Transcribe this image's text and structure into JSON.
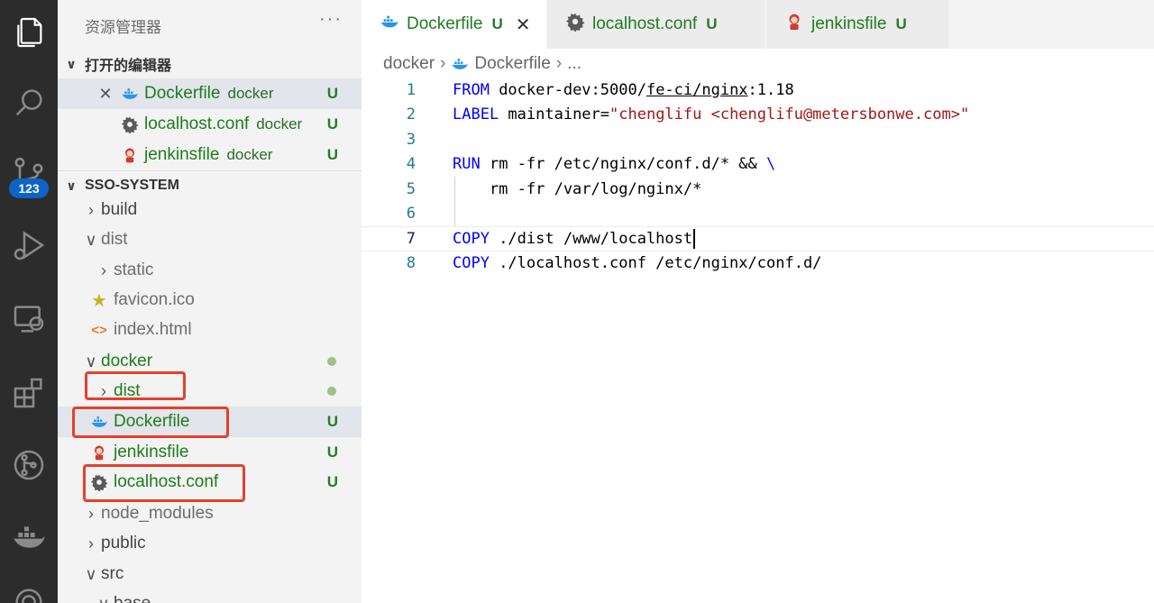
{
  "sidebar": {
    "title": "资源管理器",
    "more": "···",
    "open_editors": {
      "header": "打开的编辑器",
      "items": [
        {
          "name": "Dockerfile",
          "desc": "docker",
          "status": "U"
        },
        {
          "name": "localhost.conf",
          "desc": "docker",
          "status": "U"
        },
        {
          "name": "jenkinsfile",
          "desc": "docker",
          "status": "U"
        }
      ]
    },
    "project": {
      "header": "SSO-SYSTEM",
      "items": [
        {
          "name": "build"
        },
        {
          "name": "dist"
        },
        {
          "name": "static"
        },
        {
          "name": "favicon.ico"
        },
        {
          "name": "index.html"
        },
        {
          "name": "docker"
        },
        {
          "name": "dist"
        },
        {
          "name": "Dockerfile",
          "status": "U"
        },
        {
          "name": "jenkinsfile",
          "status": "U"
        },
        {
          "name": "localhost.conf",
          "status": "U"
        },
        {
          "name": "node_modules"
        },
        {
          "name": "public"
        },
        {
          "name": "src"
        },
        {
          "name": "base"
        }
      ]
    }
  },
  "activity": {
    "badge": "123",
    "icons": [
      "files-icon",
      "search-icon",
      "source-control-icon",
      "run-debug-icon",
      "remote-explorer-icon",
      "extensions-icon",
      "gitlens-icon",
      "docker-icon",
      "gear-icon"
    ]
  },
  "tabs": [
    {
      "label": "Dockerfile",
      "status": "U",
      "close": "✕"
    },
    {
      "label": "localhost.conf",
      "status": "U"
    },
    {
      "label": "jenkinsfile",
      "status": "U"
    }
  ],
  "breadcrumb": {
    "folder": "docker",
    "file": "Dockerfile",
    "more": "..."
  },
  "code": {
    "line_numbers": [
      "1",
      "2",
      "3",
      "4",
      "5",
      "6",
      "7",
      "8"
    ],
    "l1": {
      "kw": "FROM",
      "a": " docker-dev:5000/",
      "b": "fe-ci/nginx",
      "c": ":1.18"
    },
    "l2": {
      "kw": "LABEL",
      "a": " maintainer=",
      "str": "\"chenglifu <chenglifu@metersbonwe.com>\""
    },
    "l4": {
      "kw": "RUN",
      "a": " rm -fr /etc/nginx/conf.d/* && ",
      "bs": "\\"
    },
    "l5": {
      "a": "    rm -fr /var/log/nginx/*"
    },
    "l7": {
      "kw": "COPY",
      "a": " ./dist /www/localhost"
    },
    "l8": {
      "kw": "COPY",
      "a": " ./localhost.conf /etc/nginx/conf.d/"
    }
  },
  "colors": {
    "git_untracked": "#1e7c1e",
    "badge": "#0e63c7",
    "keyword": "#0000ff",
    "string": "#a31515",
    "highlight_box": "#e5402b"
  }
}
